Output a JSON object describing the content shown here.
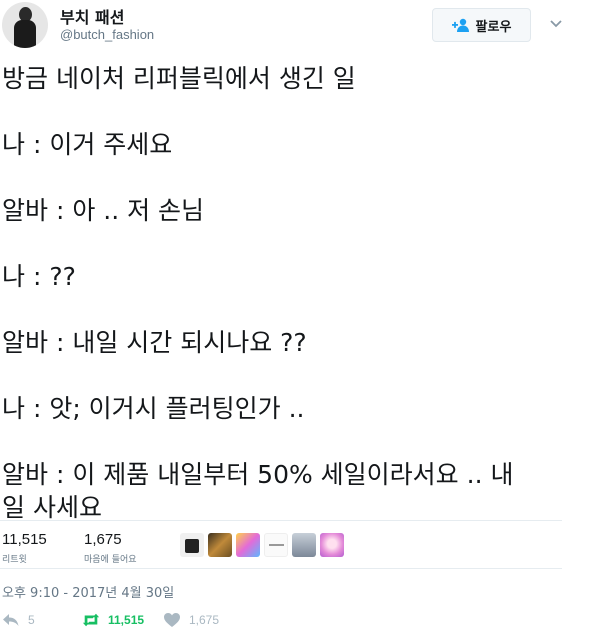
{
  "user": {
    "display_name": "부치 패션",
    "handle": "@butch_fashion",
    "follow_label": "팔로우"
  },
  "tweet": {
    "lines": [
      "방금 네이처 리퍼블릭에서 생긴 일",
      "",
      "나 : 이거 주세요",
      "",
      "알바 : 아 .. 저 손님",
      "",
      "나 : ??",
      "",
      "알바 : 내일 시간 되시나요 ??",
      "",
      "나 : 앗; 이거시 플러팅인가 ..",
      "",
      "알바 : 이 제품 내일부터 50% 세일이라서요 .. 내",
      "일 사세요"
    ]
  },
  "stats": {
    "retweets": {
      "value": "11,515",
      "label": "리트윗"
    },
    "likes": {
      "value": "1,675",
      "label": "마음에 들어요"
    }
  },
  "liker_avatars": [
    {
      "icon": "person-dark-avatar",
      "color": "#f0f0f0"
    },
    {
      "icon": "orange-photo-avatar",
      "color": "#8a6a2e"
    },
    {
      "icon": "colorful-art-avatar",
      "color": "#c97bd9"
    },
    {
      "icon": "text-sign-avatar",
      "color": "#fafafa"
    },
    {
      "icon": "tree-photo-avatar",
      "color": "#9aa6b4"
    },
    {
      "icon": "anime-girl-avatar",
      "color": "#e48bd8"
    }
  ],
  "timestamp": "오후 9:10 - 2017년 4월 30일",
  "actions": {
    "reply_count": "5",
    "retweet_count": "11,515",
    "like_count": "1,675"
  },
  "colors": {
    "retweet_green": "#17bf63",
    "muted": "#657786",
    "follow_blue": "#1da1f2"
  }
}
